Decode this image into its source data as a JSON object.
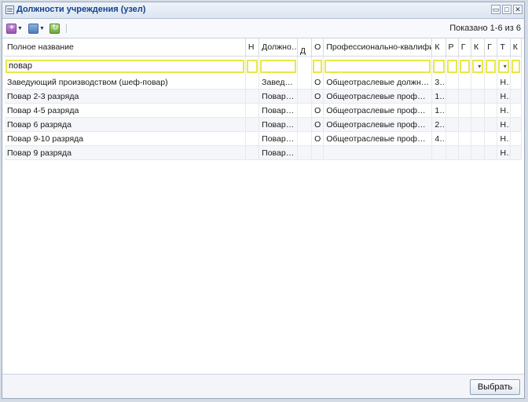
{
  "window": {
    "title": "Должности учреждения (узел)",
    "controls": {
      "minimize": "▭",
      "maximize": "□",
      "close": "✕"
    }
  },
  "toolbar": {
    "add_icon": "add-icon",
    "print_icon": "print-icon",
    "refresh_icon": "refresh-icon",
    "shown_text": "Показано 1-6 из 6"
  },
  "grid": {
    "columns": [
      "Полное название",
      "Н",
      "Должно…",
      "Д",
      "О",
      "Профессионально-квалифи…",
      "К",
      "Р",
      "Г",
      "К",
      "Г",
      "Т",
      "К"
    ],
    "filter": {
      "name": "повар"
    },
    "rows": [
      [
        "Заведующий производством (шеф-повар)",
        "",
        "Заведу…",
        "",
        "О",
        "Общеотраслевые должност…",
        "3…",
        "",
        "",
        "",
        "",
        "Н…",
        ""
      ],
      [
        "Повар 2-3 разряда",
        "",
        "Повар 2…",
        "",
        "О",
        "Общеотраслевые професси…",
        "1…",
        "",
        "",
        "",
        "",
        "Н…",
        ""
      ],
      [
        "Повар 4-5 разряда",
        "",
        "Повар 4…",
        "",
        "О",
        "Общеотраслевые професси…",
        "1…",
        "",
        "",
        "",
        "",
        "Н…",
        ""
      ],
      [
        "Повар 6 разряда",
        "",
        "Повар 6…",
        "",
        "О",
        "Общеотраслевые професси…",
        "2…",
        "",
        "",
        "",
        "",
        "Н…",
        ""
      ],
      [
        "Повар 9-10 разряда",
        "",
        "Повар 9…",
        "",
        "О",
        "Общеотраслевые професси…",
        "4…",
        "",
        "",
        "",
        "",
        "Н…",
        ""
      ],
      [
        "Повар 9 разряда",
        "",
        "Повар 9…",
        "",
        "",
        "",
        "",
        "",
        "",
        "",
        "",
        "Н…",
        ""
      ]
    ]
  },
  "footer": {
    "select_label": "Выбрать"
  }
}
